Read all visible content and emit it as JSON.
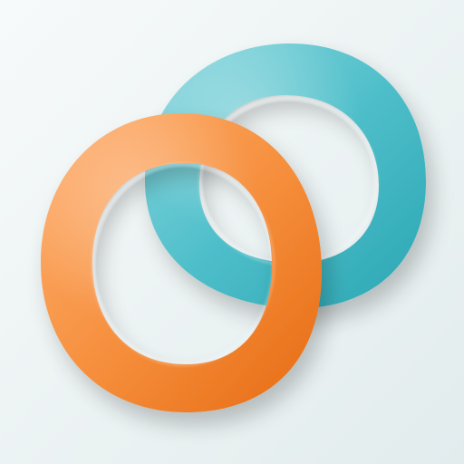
{
  "scene": {
    "background": {
      "top_left": "#f7fafa",
      "bottom_right": "#e2eced"
    },
    "rings": [
      {
        "name": "teal-ring",
        "color_light": "#8fd8df",
        "color_mid": "#4fbfca",
        "color_dark": "#2aa6b3",
        "layer": "back"
      },
      {
        "name": "orange-ring",
        "color_light": "#ffb071",
        "color_mid": "#f58d3a",
        "color_dark": "#e66a12",
        "layer": "front"
      }
    ]
  }
}
